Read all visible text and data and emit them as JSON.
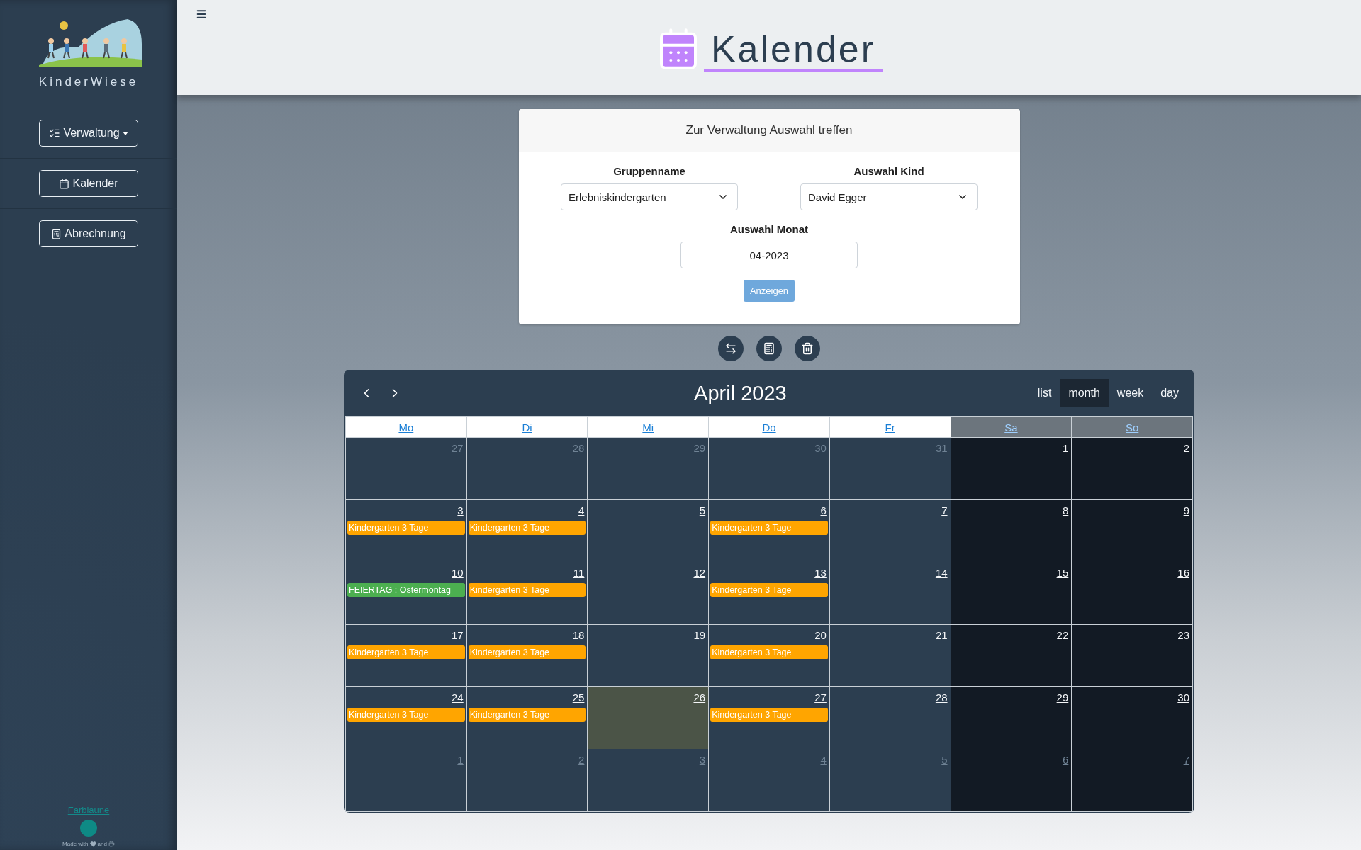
{
  "sidebar": {
    "brand": "KinderWiese",
    "nav": [
      {
        "label": "Verwaltung",
        "kind": "dropdown"
      },
      {
        "label": "Kalender",
        "kind": "link"
      },
      {
        "label": "Abrechnung",
        "kind": "link"
      }
    ],
    "footer": {
      "link": "Farblaune",
      "credit": [
        "Made with",
        "and"
      ]
    }
  },
  "header": {
    "title": "Kalender"
  },
  "form": {
    "title": "Zur Verwaltung Auswahl treffen",
    "fields": [
      {
        "label": "Gruppenname",
        "value": "Erlebniskindergarten",
        "kind": "select"
      },
      {
        "label": "Auswahl Kind",
        "value": "David Egger",
        "kind": "select"
      }
    ],
    "month": {
      "label": "Auswahl Monat",
      "value": "04-2023"
    },
    "submit": "Anzeigen"
  },
  "calendar": {
    "title": "April 2023",
    "views": [
      {
        "label": "list",
        "selected": false
      },
      {
        "label": "month",
        "selected": true
      },
      {
        "label": "week",
        "selected": false
      },
      {
        "label": "day",
        "selected": false
      }
    ],
    "weekdays": [
      {
        "label": "Mo",
        "weekend": false
      },
      {
        "label": "Di",
        "weekend": false
      },
      {
        "label": "Mi",
        "weekend": false
      },
      {
        "label": "Do",
        "weekend": false
      },
      {
        "label": "Fr",
        "weekend": false
      },
      {
        "label": "Sa",
        "weekend": true
      },
      {
        "label": "So",
        "weekend": true
      }
    ],
    "weeks": [
      [
        {
          "day": "27",
          "other": true
        },
        {
          "day": "28",
          "other": true
        },
        {
          "day": "29",
          "other": true
        },
        {
          "day": "30",
          "other": true
        },
        {
          "day": "31",
          "other": true
        },
        {
          "day": "1",
          "other": false
        },
        {
          "day": "2",
          "other": false
        }
      ],
      [
        {
          "day": "3",
          "other": false,
          "events": [
            {
              "title": "Kindergarten 3 Tage",
              "color": "#ffa500"
            }
          ]
        },
        {
          "day": "4",
          "other": false,
          "events": [
            {
              "title": "Kindergarten 3 Tage",
              "color": "#ffa500"
            }
          ]
        },
        {
          "day": "5",
          "other": false
        },
        {
          "day": "6",
          "other": false,
          "events": [
            {
              "title": "Kindergarten 3 Tage",
              "color": "#ffa500"
            }
          ]
        },
        {
          "day": "7",
          "other": false
        },
        {
          "day": "8",
          "other": false
        },
        {
          "day": "9",
          "other": false
        }
      ],
      [
        {
          "day": "10",
          "other": false,
          "events": [
            {
              "title": "FEIERTAG : Ostermontag",
              "color": "#4caf50"
            }
          ]
        },
        {
          "day": "11",
          "other": false,
          "events": [
            {
              "title": "Kindergarten 3 Tage",
              "color": "#ffa500"
            }
          ]
        },
        {
          "day": "12",
          "other": false
        },
        {
          "day": "13",
          "other": false,
          "events": [
            {
              "title": "Kindergarten 3 Tage",
              "color": "#ffa500"
            }
          ]
        },
        {
          "day": "14",
          "other": false
        },
        {
          "day": "15",
          "other": false
        },
        {
          "day": "16",
          "other": false
        }
      ],
      [
        {
          "day": "17",
          "other": false,
          "events": [
            {
              "title": "Kindergarten 3 Tage",
              "color": "#ffa500"
            }
          ]
        },
        {
          "day": "18",
          "other": false,
          "events": [
            {
              "title": "Kindergarten 3 Tage",
              "color": "#ffa500"
            }
          ]
        },
        {
          "day": "19",
          "other": false
        },
        {
          "day": "20",
          "other": false,
          "events": [
            {
              "title": "Kindergarten 3 Tage",
              "color": "#ffa500"
            }
          ]
        },
        {
          "day": "21",
          "other": false
        },
        {
          "day": "22",
          "other": false
        },
        {
          "day": "23",
          "other": false
        }
      ],
      [
        {
          "day": "24",
          "other": false,
          "events": [
            {
              "title": "Kindergarten 3 Tage",
              "color": "#ffa500"
            }
          ]
        },
        {
          "day": "25",
          "other": false,
          "events": [
            {
              "title": "Kindergarten 3 Tage",
              "color": "#ffa500"
            }
          ]
        },
        {
          "day": "26",
          "other": false,
          "today": true
        },
        {
          "day": "27",
          "other": false,
          "events": [
            {
              "title": "Kindergarten 3 Tage",
              "color": "#ffa500"
            }
          ]
        },
        {
          "day": "28",
          "other": false
        },
        {
          "day": "29",
          "other": false
        },
        {
          "day": "30",
          "other": false
        }
      ],
      [
        {
          "day": "1",
          "other": true
        },
        {
          "day": "2",
          "other": true
        },
        {
          "day": "3",
          "other": true
        },
        {
          "day": "4",
          "other": true
        },
        {
          "day": "5",
          "other": true
        },
        {
          "day": "6",
          "other": true
        },
        {
          "day": "7",
          "other": true
        }
      ]
    ]
  }
}
